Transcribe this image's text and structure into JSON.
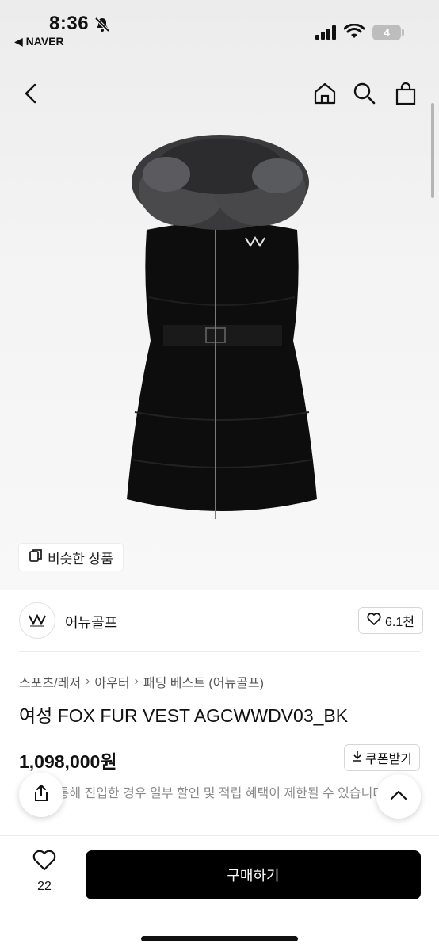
{
  "status_bar": {
    "time": "8:36",
    "back_app": "◀ NAVER",
    "battery": "4"
  },
  "icons": {
    "back": "chevron-left-icon",
    "home": "home-icon",
    "search": "search-icon",
    "cart": "shopping-bag-icon",
    "similar": "copy-icon",
    "heart": "heart-icon",
    "download": "download-icon",
    "share": "share-icon",
    "up": "chevron-up-icon"
  },
  "similar_button": {
    "label": "비슷한 상품"
  },
  "seller": {
    "name": "어뉴골프",
    "likes": "6.1천"
  },
  "breadcrumb": [
    "스포츠/레저",
    "아우터",
    "패딩 베스트 (어뉴골프)"
  ],
  "product": {
    "title": "여성 FOX FUR VEST AGCWWDV03_BK",
    "price": "1,098,000원",
    "coupon_label": "쿠폰받기",
    "notice": "링크를 통해 진입한 경우 일부 할인 및 적립 혜택이 제한될 수 있습니다."
  },
  "bottom_bar": {
    "wish_count": "22",
    "buy_label": "구매하기"
  },
  "colors": {
    "primary_button": "#000000",
    "text": "#111111",
    "muted_text": "#8a8a8a"
  }
}
